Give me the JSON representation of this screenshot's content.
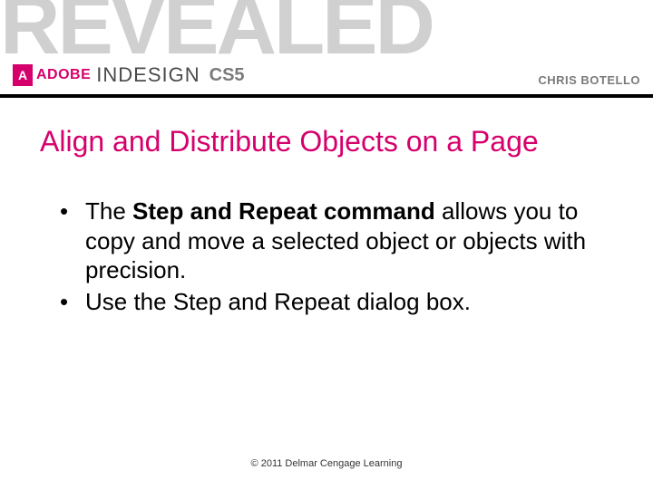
{
  "header": {
    "revealed": "REVEALED",
    "adobe": "ADOBE",
    "product": "INDESIGN",
    "version": "CS5",
    "author": "CHRIS BOTELLO"
  },
  "title": "Align and Distribute Objects on a Page",
  "bullets": {
    "b1_pre": "The ",
    "b1_bold": "Step and Repeat command",
    "b1_post": " allows you to copy and move a selected object or objects with precision.",
    "b2": "Use the Step and Repeat dialog box."
  },
  "footer": "© 2011 Delmar Cengage Learning"
}
